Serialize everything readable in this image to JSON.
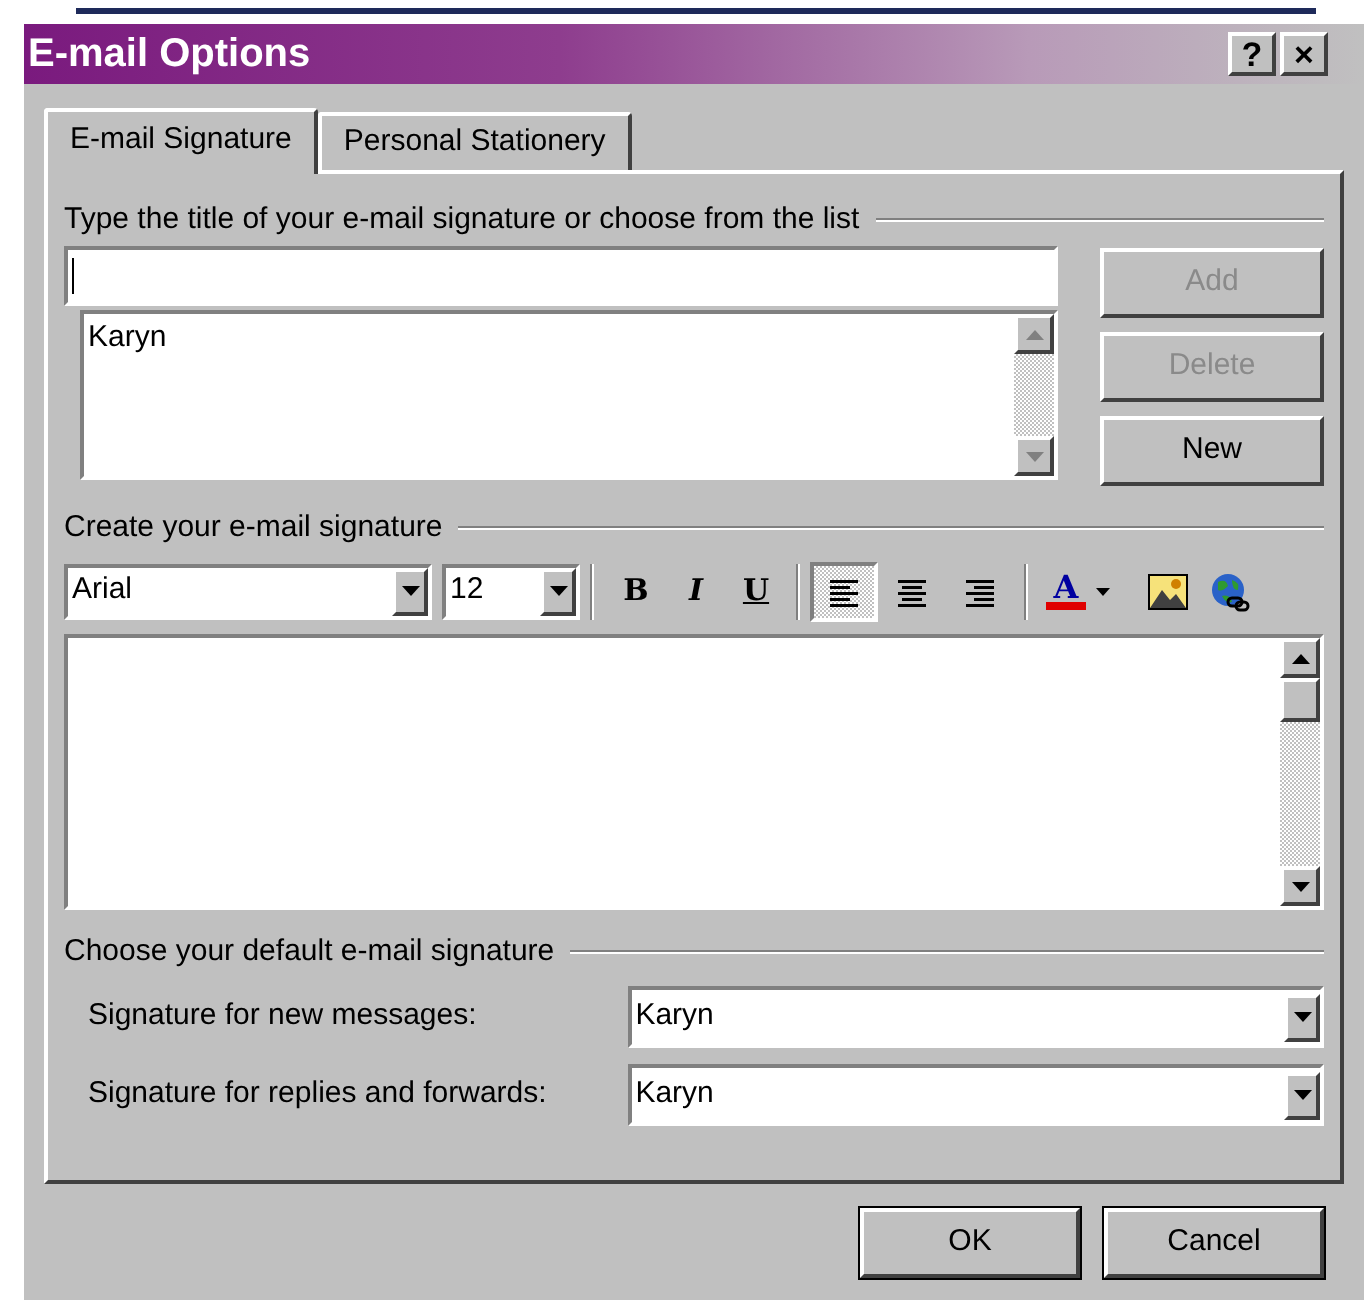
{
  "window": {
    "title": "E-mail Options",
    "title_buttons": [
      "?",
      "×"
    ]
  },
  "tabs": [
    {
      "label": "E-mail Signature",
      "selected": true
    },
    {
      "label": "Personal Stationery",
      "selected": false
    }
  ],
  "signature_title": {
    "label": "Type the title of your e-mail signature or choose from the list"
  },
  "signature_list": {
    "items": [
      "Karyn"
    ]
  },
  "list_buttons": [
    {
      "label": "Add",
      "disabled": true
    },
    {
      "label": "Delete",
      "disabled": true
    },
    {
      "label": "New",
      "disabled": false
    }
  ],
  "editor": {
    "label": "Create your e-mail signature",
    "font": "Arial",
    "size": "12",
    "toolbar": [
      {
        "kind": "bold",
        "text": "B"
      },
      {
        "kind": "italic",
        "text": "I"
      },
      {
        "kind": "underline",
        "text": "U"
      },
      {
        "kind": "separator"
      },
      {
        "kind": "align-left",
        "selected": true
      },
      {
        "kind": "align-center",
        "selected": false
      },
      {
        "kind": "align-right",
        "selected": false
      },
      {
        "kind": "separator"
      },
      {
        "kind": "font-color",
        "text": "A"
      },
      {
        "kind": "picture"
      },
      {
        "kind": "hyperlink"
      }
    ]
  },
  "defaults": {
    "label": "Choose your default e-mail signature",
    "rows": [
      {
        "label": "Signature for new messages:",
        "value": "Karyn"
      },
      {
        "label": "Signature for replies and forwards:",
        "value": "Karyn"
      }
    ]
  },
  "buttons": [
    {
      "label": "OK"
    },
    {
      "label": "Cancel"
    }
  ]
}
